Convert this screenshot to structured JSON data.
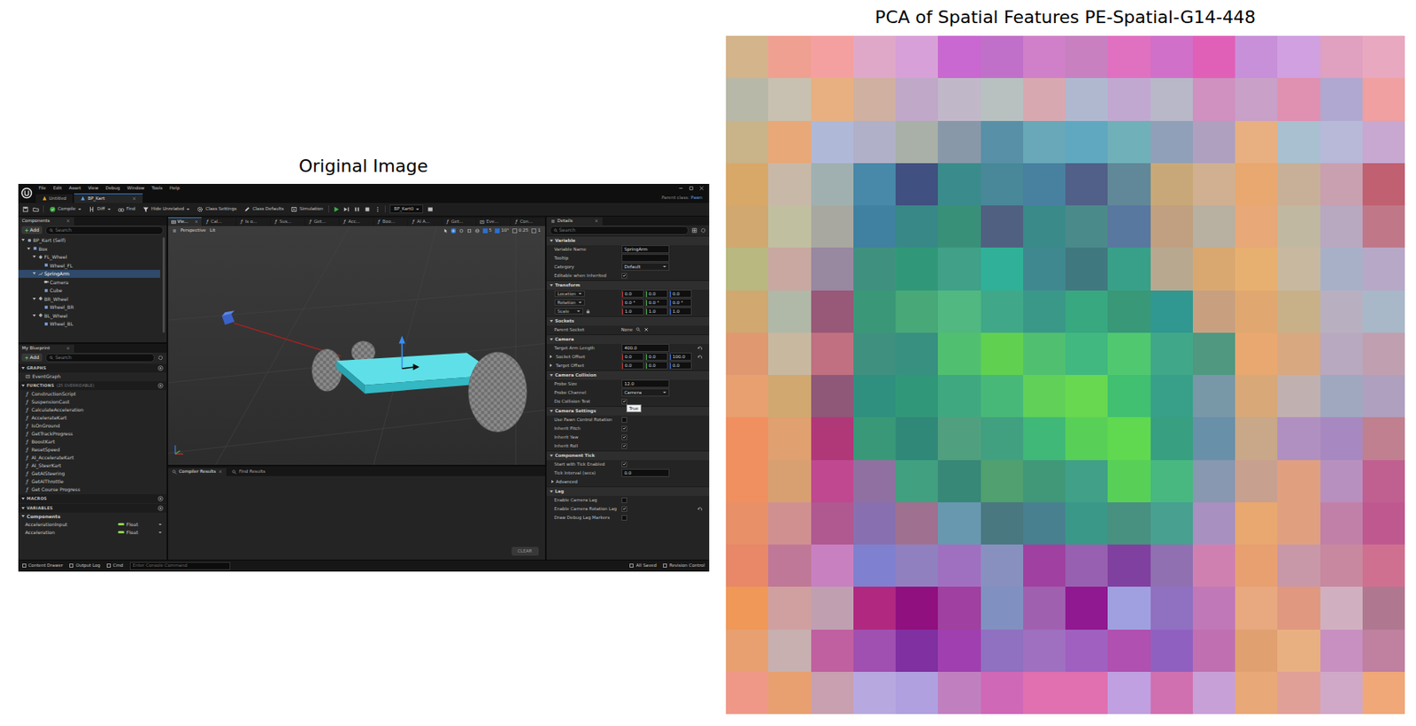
{
  "figure": {
    "left_title": "Original Image",
    "right_title": "PCA of Spatial Features PE-Spatial-G14-448"
  },
  "editor": {
    "function_glyph": "ƒ",
    "menu": [
      "File",
      "Edit",
      "Asset",
      "View",
      "Debug",
      "Window",
      "Tools",
      "Help"
    ],
    "doc_tabs": [
      {
        "label": "Untitled",
        "selected": false
      },
      {
        "label": "BP_Kart",
        "selected": true
      }
    ],
    "parent_class": {
      "label": "Parent class:",
      "value": "Pawn"
    },
    "toolbar": [
      {
        "label": "Compile",
        "kind": "compile",
        "menu": true
      },
      {
        "label": "Diff",
        "kind": "diff",
        "menu": true
      },
      {
        "label": "Find",
        "kind": "find",
        "menu": false
      },
      {
        "label": "Hide Unrelated",
        "kind": "filter",
        "menu": true
      },
      {
        "label": "Class Settings",
        "kind": "settings",
        "menu": false
      },
      {
        "label": "Class Defaults",
        "kind": "defaults",
        "menu": false
      },
      {
        "label": "Simulation",
        "kind": "simulation",
        "menu": false
      }
    ],
    "debug_object": "BP_Kart0",
    "components": {
      "title": "Components",
      "add": "Add",
      "search": "Search",
      "tree": [
        {
          "label": "BP_Kart (Self)",
          "kind": "actor",
          "expanded": true,
          "selected": false,
          "children": [
            {
              "label": "Box",
              "kind": "mesh",
              "expanded": true,
              "selected": false,
              "children": [
                {
                  "label": "FL_Wheel",
                  "kind": "scene",
                  "expanded": true,
                  "selected": false,
                  "children": [
                    {
                      "label": "Wheel_FL",
                      "kind": "mesh",
                      "expanded": false,
                      "selected": false,
                      "children": []
                    }
                  ]
                },
                {
                  "label": "SpringArm",
                  "kind": "springarm",
                  "expanded": true,
                  "selected": true,
                  "children": [
                    {
                      "label": "Camera",
                      "kind": "camera",
                      "expanded": false,
                      "selected": false,
                      "children": []
                    },
                    {
                      "label": "Cube",
                      "kind": "mesh",
                      "expanded": false,
                      "selected": false,
                      "children": []
                    }
                  ]
                },
                {
                  "label": "BR_Wheel",
                  "kind": "scene",
                  "expanded": true,
                  "selected": false,
                  "children": [
                    {
                      "label": "Wheel_BR",
                      "kind": "mesh",
                      "expanded": false,
                      "selected": false,
                      "children": []
                    }
                  ]
                },
                {
                  "label": "BL_Wheel",
                  "kind": "scene",
                  "expanded": true,
                  "selected": false,
                  "children": [
                    {
                      "label": "Wheel_BL",
                      "kind": "mesh",
                      "expanded": false,
                      "selected": false,
                      "children": []
                    }
                  ]
                }
              ]
            }
          ]
        }
      ]
    },
    "blueprint": {
      "title": "My Blueprint",
      "add": "Add",
      "search": "Search",
      "sections": [
        {
          "title": "GRAPHS",
          "count": "",
          "expanded": true,
          "items": [
            {
              "name": "EventGraph",
              "kind": "graph"
            }
          ]
        },
        {
          "title": "FUNCTIONS",
          "count": "(25 OVERRIDABLE)",
          "expanded": true,
          "items": [
            {
              "name": "ConstructionScript",
              "kind": "function"
            },
            {
              "name": "SuspensionCast",
              "kind": "function"
            },
            {
              "name": "CalculateAcceleration",
              "kind": "function"
            },
            {
              "name": "AccelerateKart",
              "kind": "function"
            },
            {
              "name": "IsOnGround",
              "kind": "function"
            },
            {
              "name": "GetTrackProgress",
              "kind": "function"
            },
            {
              "name": "BoostKart",
              "kind": "function"
            },
            {
              "name": "ResetSpeed",
              "kind": "function"
            },
            {
              "name": "AI_AccelerateKart",
              "kind": "function"
            },
            {
              "name": "AI_SteerKart",
              "kind": "function"
            },
            {
              "name": "GetAISteering",
              "kind": "function"
            },
            {
              "name": "GetAIThrottle",
              "kind": "function"
            },
            {
              "name": "Get Course Progress",
              "kind": "function"
            }
          ]
        },
        {
          "title": "MACROS",
          "count": "",
          "expanded": true,
          "items": []
        },
        {
          "title": "VARIABLES",
          "count": "",
          "expanded": true,
          "items": [
            {
              "name": "Components",
              "kind": "category",
              "type": "",
              "color": "#000000"
            },
            {
              "name": "AccelerationInput",
              "kind": "variable",
              "type": "Float",
              "color": "#8fd14f"
            },
            {
              "name": "Acceleration",
              "kind": "variable",
              "type": "Float",
              "color": "#8fd14f"
            }
          ]
        }
      ]
    },
    "viewport_tabs": [
      {
        "label": "Vie...",
        "kind": "viewport",
        "selected": true
      },
      {
        "label": "Cal...",
        "kind": "function",
        "selected": false
      },
      {
        "label": "Is o...",
        "kind": "function",
        "selected": false
      },
      {
        "label": "Sus...",
        "kind": "function",
        "selected": false
      },
      {
        "label": "Get...",
        "kind": "function",
        "selected": false
      },
      {
        "label": "Acc...",
        "kind": "function",
        "selected": false
      },
      {
        "label": "Boo...",
        "kind": "function",
        "selected": false
      },
      {
        "label": "AI A...",
        "kind": "function",
        "selected": false
      },
      {
        "label": "Get...",
        "kind": "function",
        "selected": false
      },
      {
        "label": "Eve...",
        "kind": "graph",
        "selected": false
      },
      {
        "label": "Con...",
        "kind": "function",
        "selected": false
      }
    ],
    "viewport_toolbar": {
      "left": [
        "Perspective",
        "Lit"
      ],
      "snaps": [
        {
          "value": "5",
          "on": true
        },
        {
          "value": "10°",
          "on": true
        },
        {
          "value": "0.25",
          "on": false
        },
        {
          "value": "1",
          "on": false
        }
      ]
    },
    "bottom_tabs": [
      {
        "label": "Compiler Results",
        "selected": true
      },
      {
        "label": "Find Results",
        "selected": false
      }
    ],
    "clear": "CLEAR",
    "details": {
      "title": "Details",
      "search": "Search",
      "sections": [
        {
          "title": "Variable",
          "expanded": true,
          "rows": [
            {
              "kind": "text",
              "label": "Variable Name",
              "value": "SpringArm",
              "reset": false
            },
            {
              "kind": "text",
              "label": "Tooltip",
              "value": "",
              "reset": false
            },
            {
              "kind": "dropdown",
              "label": "Category",
              "value": "Default",
              "reset": false
            },
            {
              "kind": "check",
              "label": "Editable when Inherited",
              "checked": true,
              "reset": false
            }
          ]
        },
        {
          "title": "Transform",
          "expanded": true,
          "rows": [
            {
              "kind": "vector",
              "label": "Location",
              "dropdown": true,
              "lock": false,
              "values": [
                "0.0",
                "0.0",
                "0.0"
              ],
              "reset": false
            },
            {
              "kind": "vector",
              "label": "Rotation",
              "dropdown": true,
              "lock": false,
              "values": [
                "0.0 °",
                "0.0 °",
                "0.0 °"
              ],
              "reset": false
            },
            {
              "kind": "vector",
              "label": "Scale",
              "dropdown": true,
              "lock": true,
              "values": [
                "1.0",
                "1.0",
                "1.0"
              ],
              "reset": false
            }
          ]
        },
        {
          "title": "Sockets",
          "expanded": true,
          "rows": [
            {
              "kind": "socket",
              "label": "Parent Socket",
              "value": "None",
              "reset": false
            }
          ]
        },
        {
          "title": "Camera",
          "expanded": true,
          "rows": [
            {
              "kind": "text",
              "label": "Target Arm Length",
              "value": "400.0",
              "reset": true
            },
            {
              "kind": "vector",
              "label": "Socket Offset",
              "dropdown": false,
              "lock": false,
              "values": [
                "0.0",
                "0.0",
                "100.0"
              ],
              "reset": true
            },
            {
              "kind": "vector",
              "label": "Target Offset",
              "dropdown": false,
              "lock": false,
              "values": [
                "0.0",
                "0.0",
                "0.0"
              ],
              "reset": false
            }
          ]
        },
        {
          "title": "Camera Collision",
          "expanded": true,
          "rows": [
            {
              "kind": "text",
              "label": "Probe Size",
              "value": "12.0",
              "reset": false
            },
            {
              "kind": "dropdown",
              "label": "Probe Channel",
              "value": "Camera",
              "reset": false
            },
            {
              "kind": "check",
              "label": "Do Collision Test",
              "checked": true,
              "reset": false,
              "tooltip": "True"
            }
          ]
        },
        {
          "title": "Camera Settings",
          "expanded": true,
          "rows": [
            {
              "kind": "check",
              "label": "Use Pawn Control Rotation",
              "checked": false,
              "reset": false
            },
            {
              "kind": "check",
              "label": "Inherit Pitch",
              "checked": true,
              "reset": false
            },
            {
              "kind": "check",
              "label": "Inherit Yaw",
              "checked": true,
              "reset": false
            },
            {
              "kind": "check",
              "label": "Inherit Roll",
              "checked": true,
              "reset": false
            }
          ]
        },
        {
          "title": "Component Tick",
          "expanded": true,
          "rows": [
            {
              "kind": "check",
              "label": "Start with Tick Enabled",
              "checked": true,
              "reset": false
            },
            {
              "kind": "text",
              "label": "Tick Interval (secs)",
              "value": "0.0",
              "reset": false
            },
            {
              "kind": "group",
              "label": "Advanced",
              "expanded": false,
              "reset": false
            }
          ]
        },
        {
          "title": "Lag",
          "expanded": true,
          "rows": [
            {
              "kind": "check",
              "label": "Enable Camera Lag",
              "checked": false,
              "reset": false
            },
            {
              "kind": "check",
              "label": "Enable Camera Rotation Lag",
              "checked": true,
              "reset": true
            },
            {
              "kind": "check",
              "label": "Draw Debug Lag Markers",
              "checked": false,
              "reset": false
            }
          ]
        }
      ]
    },
    "status_bar": {
      "left": [
        "Content Drawer",
        "Output Log",
        "Cmd"
      ],
      "console_placeholder": "Enter Console Command",
      "right": [
        "All Saved",
        "Revision Control"
      ]
    }
  },
  "chart": {
    "grid": [
      [
        "#d4b48a",
        "#f0a090",
        "#f5a0a0",
        "#e0a8c8",
        "#d8a0d8",
        "#c868d0",
        "#c070c8",
        "#d080c8",
        "#c880c0",
        "#e070c0",
        "#d070c8",
        "#e060b8",
        "#c890d8",
        "#d0a0e0",
        "#e0a0c0",
        "#e8a8c0"
      ],
      [
        "#b8b8a8",
        "#c8c0b0",
        "#e8b080",
        "#d0b0a0",
        "#c0a8c8",
        "#c0b8c8",
        "#b8c0c0",
        "#d8a8b0",
        "#b0b8d0",
        "#c0a8d0",
        "#b8b8c8",
        "#d090c0",
        "#c8a0c8",
        "#e090b0",
        "#b0a8d0",
        "#f0a0a0"
      ],
      [
        "#c8b488",
        "#e8a878",
        "#b0b8d8",
        "#b0b0c8",
        "#a8b0a8",
        "#8898a8",
        "#5890a8",
        "#68a8b8",
        "#60a8c0",
        "#70b0b8",
        "#90a0b8",
        "#b0a0c0",
        "#e8b080",
        "#a8c0d0",
        "#b8b8d8",
        "#c8a8d0"
      ],
      [
        "#d8a868",
        "#c8b8a8",
        "#a0b0b0",
        "#4888a8",
        "#405080",
        "#3a8c8c",
        "#488898",
        "#4880a0",
        "#506088",
        "#608898",
        "#c8a878",
        "#d0b090",
        "#e8a870",
        "#c8b098",
        "#c8a0b0",
        "#c06070"
      ],
      [
        "#d0a870",
        "#c0c0a0",
        "#a8a8a0",
        "#4080a0",
        "#388888",
        "#389078",
        "#506080",
        "#3a8a8a",
        "#4a8a8a",
        "#5878a0",
        "#c0a080",
        "#b8b0a0",
        "#e8a878",
        "#c0b8a0",
        "#b8a8c0",
        "#c07888"
      ],
      [
        "#b8b880",
        "#c8a8a0",
        "#9888a0",
        "#409080",
        "#309878",
        "#40a088",
        "#30b098",
        "#408890",
        "#407880",
        "#38a088",
        "#b8a890",
        "#d8a870",
        "#e8b070",
        "#c8b8a0",
        "#a8b0c8",
        "#b8a8c8"
      ],
      [
        "#d0a870",
        "#b0b8a8",
        "#985878",
        "#3a9878",
        "#48a878",
        "#50b880",
        "#40a888",
        "#3a9888",
        "#38a880",
        "#389878",
        "#309890",
        "#c8a080",
        "#e0a870",
        "#c8b088",
        "#b8b0c0",
        "#a8b8c8"
      ],
      [
        "#e09870",
        "#c8b8a0",
        "#c07080",
        "#409080",
        "#389080",
        "#50c070",
        "#60d050",
        "#50c070",
        "#40b880",
        "#50c870",
        "#40a888",
        "#509880",
        "#e8a870",
        "#d8a880",
        "#b8a8c0",
        "#c0a0b0"
      ],
      [
        "#e8a070",
        "#d0a870",
        "#905878",
        "#309080",
        "#309878",
        "#40a880",
        "#48b878",
        "#60d058",
        "#68d850",
        "#40c070",
        "#38a088",
        "#7898a8",
        "#d8a878",
        "#c0b0b0",
        "#a0a8c0",
        "#b0a0c0"
      ],
      [
        "#f09060",
        "#e0a070",
        "#b03878",
        "#389878",
        "#308878",
        "#50a080",
        "#40a080",
        "#40b878",
        "#58d058",
        "#60d850",
        "#38a080",
        "#6890a8",
        "#c8a888",
        "#b090c0",
        "#a888c0",
        "#c08090"
      ],
      [
        "#f09060",
        "#d8a070",
        "#c04890",
        "#9070a0",
        "#40a080",
        "#388878",
        "#50a070",
        "#409878",
        "#40a088",
        "#58d058",
        "#48b880",
        "#8898b0",
        "#c8a090",
        "#e0a080",
        "#b890c0",
        "#c06090"
      ],
      [
        "#e89068",
        "#d09090",
        "#b05890",
        "#8870b0",
        "#a07090",
        "#6898b0",
        "#4a7880",
        "#488090",
        "#3a9888",
        "#489080",
        "#48a090",
        "#a890c0",
        "#e8a870",
        "#e0a080",
        "#c080a8",
        "#c05890"
      ],
      [
        "#e88868",
        "#c07898",
        "#c880c0",
        "#8080d0",
        "#9080c0",
        "#a070c0",
        "#8890c0",
        "#a040a0",
        "#9860b0",
        "#8040a0",
        "#9070b0",
        "#d080b0",
        "#e8a070",
        "#c898a8",
        "#c888a0",
        "#d07090"
      ],
      [
        "#f09858",
        "#d0a0a0",
        "#c0a0b0",
        "#b02880",
        "#901080",
        "#a040a0",
        "#8090c0",
        "#a060b0",
        "#901890",
        "#a0a0e0",
        "#9070c0",
        "#c078b8",
        "#e8a880",
        "#e09880",
        "#d0b0c0",
        "#b07890"
      ],
      [
        "#e8a070",
        "#c8b0b0",
        "#c060a0",
        "#a050b0",
        "#8030a0",
        "#a040b0",
        "#9070c0",
        "#a070c0",
        "#a060c0",
        "#b050b0",
        "#9060c0",
        "#c070b0",
        "#e0a070",
        "#e8b080",
        "#c890c0",
        "#c080a0"
      ],
      [
        "#f09888",
        "#e8a070",
        "#c8a0b0",
        "#b8a8e0",
        "#b0a0e0",
        "#c080c0",
        "#d068b8",
        "#e070b0",
        "#e070b0",
        "#c0a0e0",
        "#d070b0",
        "#c8a0d8",
        "#e8a878",
        "#e0a098",
        "#d0a8c8",
        "#f0a878"
      ]
    ]
  }
}
